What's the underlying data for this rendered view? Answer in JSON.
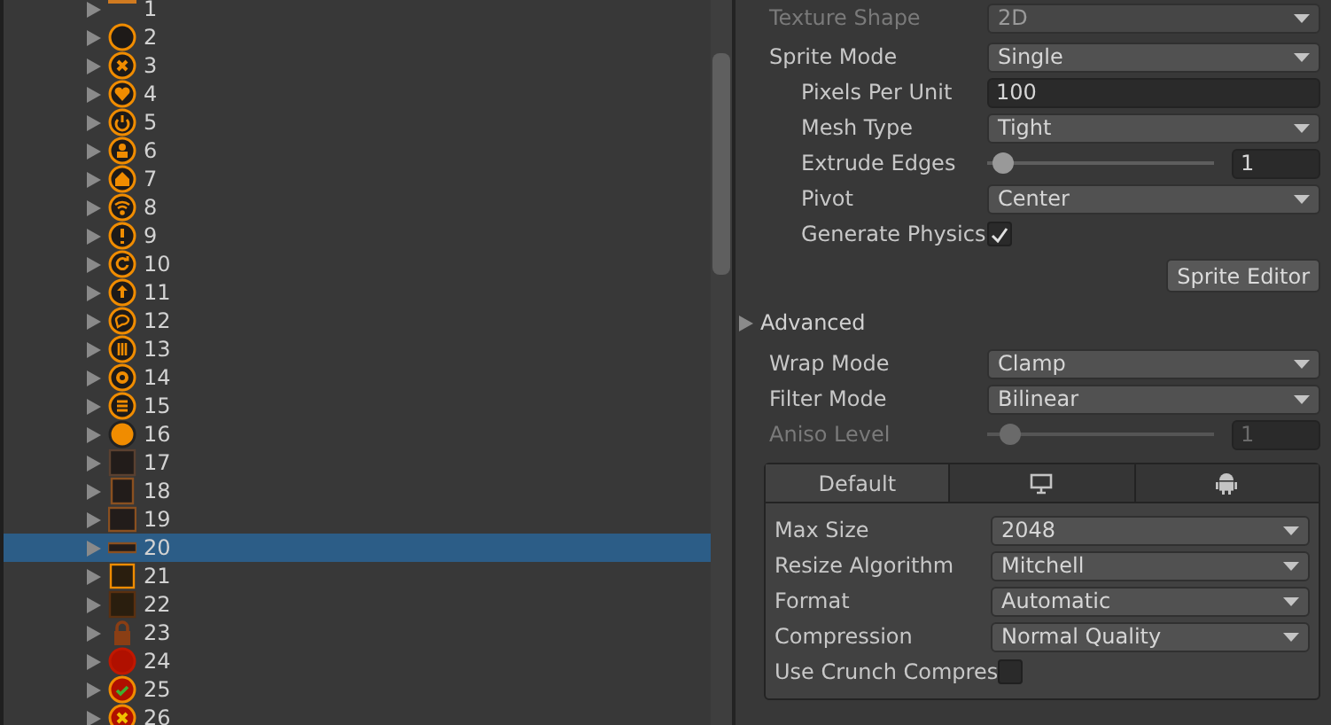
{
  "hierarchy": {
    "items": [
      {
        "label": "1",
        "selected": false
      },
      {
        "label": "2",
        "selected": false
      },
      {
        "label": "3",
        "selected": false
      },
      {
        "label": "4",
        "selected": false
      },
      {
        "label": "5",
        "selected": false
      },
      {
        "label": "6",
        "selected": false
      },
      {
        "label": "7",
        "selected": false
      },
      {
        "label": "8",
        "selected": false
      },
      {
        "label": "9",
        "selected": false
      },
      {
        "label": "10",
        "selected": false
      },
      {
        "label": "11",
        "selected": false
      },
      {
        "label": "12",
        "selected": false
      },
      {
        "label": "13",
        "selected": false
      },
      {
        "label": "14",
        "selected": false
      },
      {
        "label": "15",
        "selected": false
      },
      {
        "label": "16",
        "selected": false
      },
      {
        "label": "17",
        "selected": false
      },
      {
        "label": "18",
        "selected": false
      },
      {
        "label": "19",
        "selected": false
      },
      {
        "label": "20",
        "selected": true
      },
      {
        "label": "21",
        "selected": false
      },
      {
        "label": "22",
        "selected": false
      },
      {
        "label": "23",
        "selected": false
      },
      {
        "label": "24",
        "selected": false
      },
      {
        "label": "25",
        "selected": false
      },
      {
        "label": "26",
        "selected": false
      }
    ]
  },
  "inspector": {
    "fields": [
      {
        "kind": "dropdown",
        "label": "Texture Shape",
        "value": "2D",
        "disabled": true
      },
      {
        "kind": "dropdown",
        "label": "Sprite Mode",
        "value": "Single",
        "disabled": false,
        "children": [
          {
            "kind": "number",
            "label": "Pixels Per Unit",
            "value": "100",
            "disabled": false
          },
          {
            "kind": "dropdown",
            "label": "Mesh Type",
            "value": "Tight",
            "disabled": false
          },
          {
            "kind": "slider",
            "label": "Extrude Edges",
            "value": "1",
            "level": 0.07,
            "disabled": false
          },
          {
            "kind": "dropdown",
            "label": "Pivot",
            "value": "Center",
            "disabled": false
          },
          {
            "kind": "checkbox",
            "label": "Generate Physics",
            "checked": true,
            "disabled": false
          }
        ]
      }
    ],
    "sprite_editor_button": "Sprite Editor",
    "advanced": {
      "label": "Advanced",
      "expanded": false
    },
    "sampling": [
      {
        "kind": "dropdown",
        "label": "Wrap Mode",
        "value": "Clamp",
        "disabled": false
      },
      {
        "kind": "dropdown",
        "label": "Filter Mode",
        "value": "Bilinear",
        "disabled": false
      },
      {
        "kind": "slider",
        "label": "Aniso Level",
        "value": "1",
        "level": 0.1,
        "disabled": true
      }
    ],
    "platform_tabs": [
      {
        "label": "Default",
        "selected": true
      },
      {
        "selected": false
      },
      {
        "selected": false
      }
    ],
    "platform_fields": [
      {
        "kind": "dropdown",
        "label": "Max Size",
        "value": "2048",
        "disabled": false
      },
      {
        "kind": "dropdown",
        "label": "Resize Algorithm",
        "value": "Mitchell",
        "disabled": false
      },
      {
        "kind": "dropdown",
        "label": "Format",
        "value": "Automatic",
        "disabled": false
      },
      {
        "kind": "dropdown",
        "label": "Compression",
        "value": "Normal Quality",
        "disabled": false
      },
      {
        "kind": "checkbox",
        "label": "Use Crunch Compres",
        "checked": false,
        "disabled": false
      }
    ]
  }
}
